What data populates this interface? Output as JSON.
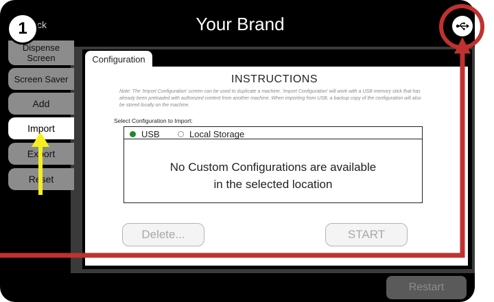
{
  "header": {
    "title": "Your Brand",
    "back_label": "ck",
    "step_number": "1",
    "usb_icon": "usb-icon"
  },
  "sidebar": {
    "items": [
      {
        "label": "Dispense Screen",
        "state": "inactive"
      },
      {
        "label": "Screen Saver",
        "state": "inactive"
      },
      {
        "label": "Add",
        "state": "inactive"
      },
      {
        "label": "Import",
        "state": "active"
      },
      {
        "label": "Export",
        "state": "inactive"
      },
      {
        "label": "Reset",
        "state": "inactive"
      }
    ]
  },
  "main": {
    "tab_label": "Configuration",
    "instructions_title": "INSTRUCTIONS",
    "note": "Note: The 'Import Configuration' screen can be used to duplicate a machine. 'Import Configuration' will work with a USB memory stick that has already been preloaded with authorized content from another machine. When importing from USB, a backup copy of the configuration will also be stored locally on the machine.",
    "select_label": "Select Configuration to Import:",
    "sources": [
      {
        "label": "USB",
        "selected": true
      },
      {
        "label": "Local Storage",
        "selected": false
      }
    ],
    "empty_message_line1": "No Custom Configurations are available",
    "empty_message_line2": "in the selected location",
    "delete_label": "Delete...",
    "start_label": "START"
  },
  "footer": {
    "restart_label": "Restart"
  },
  "colors": {
    "annotation_red": "#c0312f",
    "annotation_yellow": "#f7ee1e",
    "selected_radio": "#1c8a2e"
  }
}
